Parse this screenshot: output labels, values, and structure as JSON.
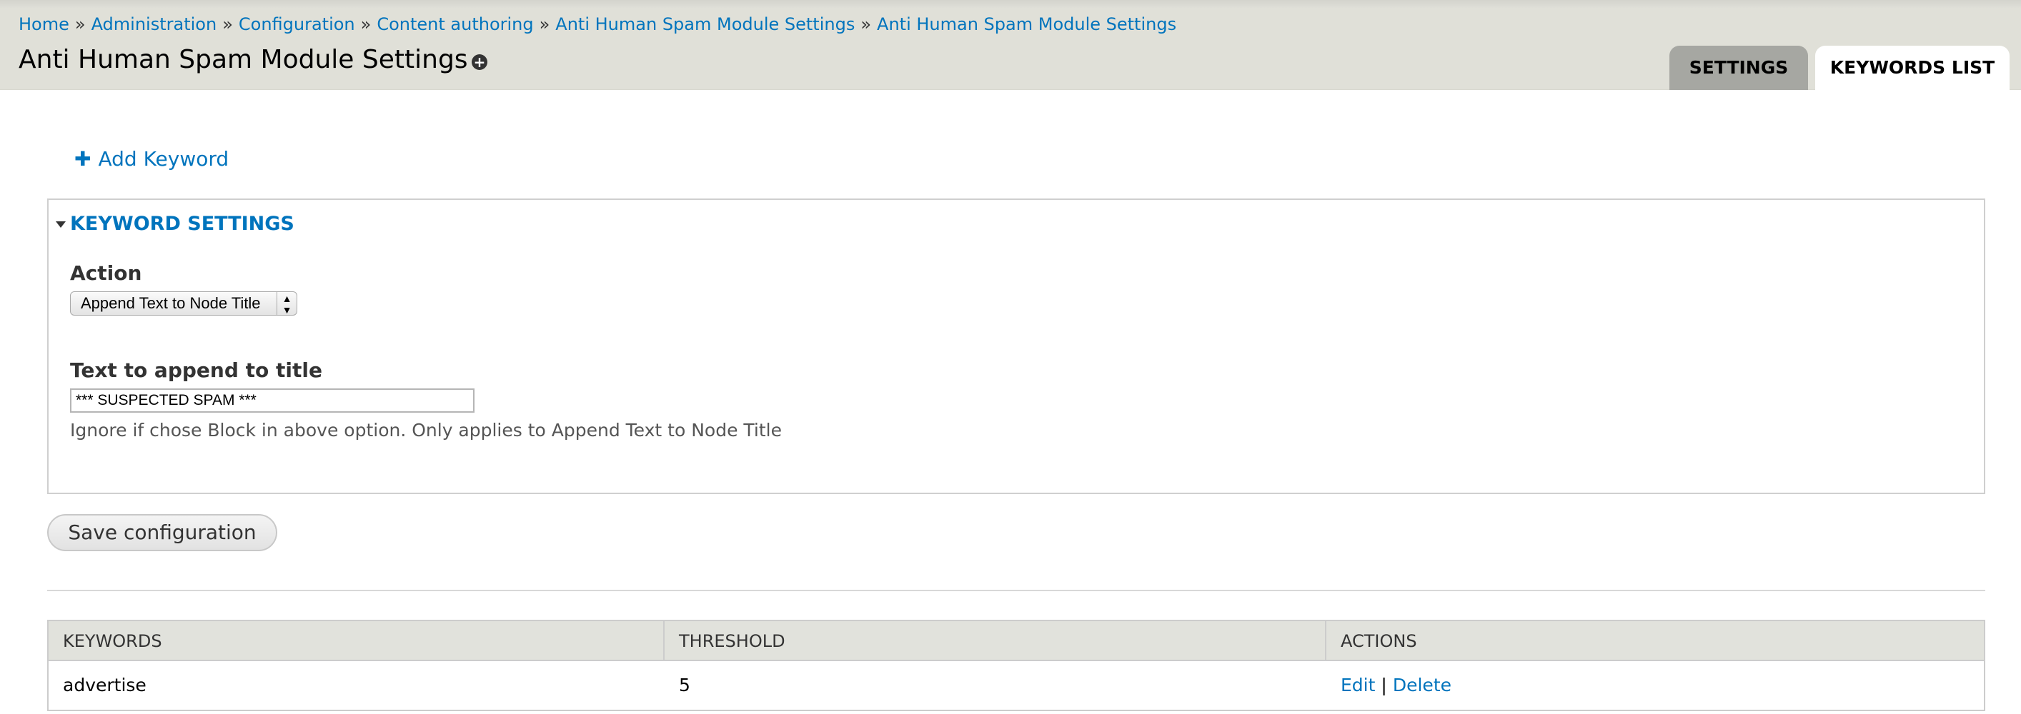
{
  "breadcrumb": {
    "items": [
      "Home",
      "Administration",
      "Configuration",
      "Content authoring",
      "Anti Human Spam Module Settings",
      "Anti Human Spam Module Settings"
    ],
    "separator": "»"
  },
  "page": {
    "title": "Anti Human Spam Module Settings",
    "shortcut_icon": "plus-circle-icon"
  },
  "tabs": [
    {
      "label": "Settings",
      "active": false
    },
    {
      "label": "Keywords list",
      "active": true
    }
  ],
  "actions": {
    "add_keyword": "Add Keyword",
    "add_icon": "plus-icon"
  },
  "fieldset": {
    "legend": "Keyword Settings",
    "action_label": "Action",
    "action_value": "Append Text to Node Title",
    "text_label": "Text to append to title",
    "text_value": "*** SUSPECTED SPAM ***",
    "description": "Ignore if chose Block in above option. Only applies to Append Text to Node Title"
  },
  "form": {
    "save_label": "Save configuration"
  },
  "table": {
    "headers": [
      "Keywords",
      "Threshold",
      "Actions"
    ],
    "rows": [
      {
        "keyword": "advertise",
        "threshold": "5",
        "edit": "Edit",
        "separator": "|",
        "delete": "Delete"
      }
    ]
  },
  "colors": {
    "link": "#0074bd",
    "header_bg": "#e0e0d8",
    "active_tab_bg": "#ffffff",
    "inactive_tab_bg": "#a6a7a2",
    "table_header_bg": "#e1e2dc"
  }
}
